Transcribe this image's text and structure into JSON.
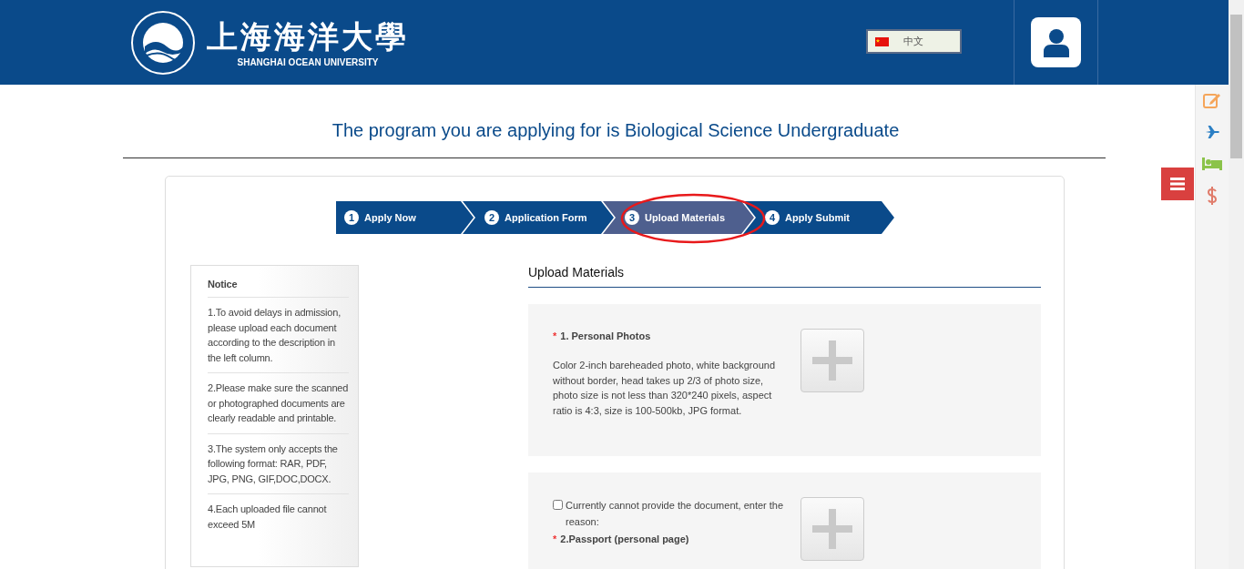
{
  "header": {
    "logo_chinese": "上海海洋大學",
    "logo_english": "SHANGHAI OCEAN UNIVERSITY",
    "language": "中文"
  },
  "title": "The program you are applying for is Biological Science Undergraduate",
  "steps": [
    {
      "number": "1",
      "label": "Apply Now",
      "selected": false
    },
    {
      "number": "2",
      "label": "Application Form",
      "selected": false
    },
    {
      "number": "3",
      "label": "Upload Materials",
      "selected": true
    },
    {
      "number": "4",
      "label": "Apply Submit",
      "selected": false
    }
  ],
  "notice": {
    "heading": "Notice",
    "items": [
      "1.To avoid delays in admission, please upload each document according to the description in the left column.",
      "2.Please make sure the scanned or photographed documents are clearly readable and printable.",
      "3.The system only accepts the following format: RAR, PDF, JPG, PNG, GIF,DOC,DOCX.",
      "4.Each uploaded file cannot exceed 5M"
    ]
  },
  "upload": {
    "heading": "Upload Materials",
    "items": [
      {
        "title": "1. Personal Photos",
        "required_mark": "*",
        "description": "Color 2-inch bareheaded photo, white background without border, head takes up 2/3 of photo size, photo size is not less than 320*240 pixels, aspect ratio is 4:3, size is 100-500kb, JPG format."
      },
      {
        "title": "2.Passport (personal page)",
        "required_mark": "*",
        "unavailable_option": {
          "label": "Currently cannot provide the document, enter the reason:",
          "checked": false
        }
      }
    ]
  }
}
